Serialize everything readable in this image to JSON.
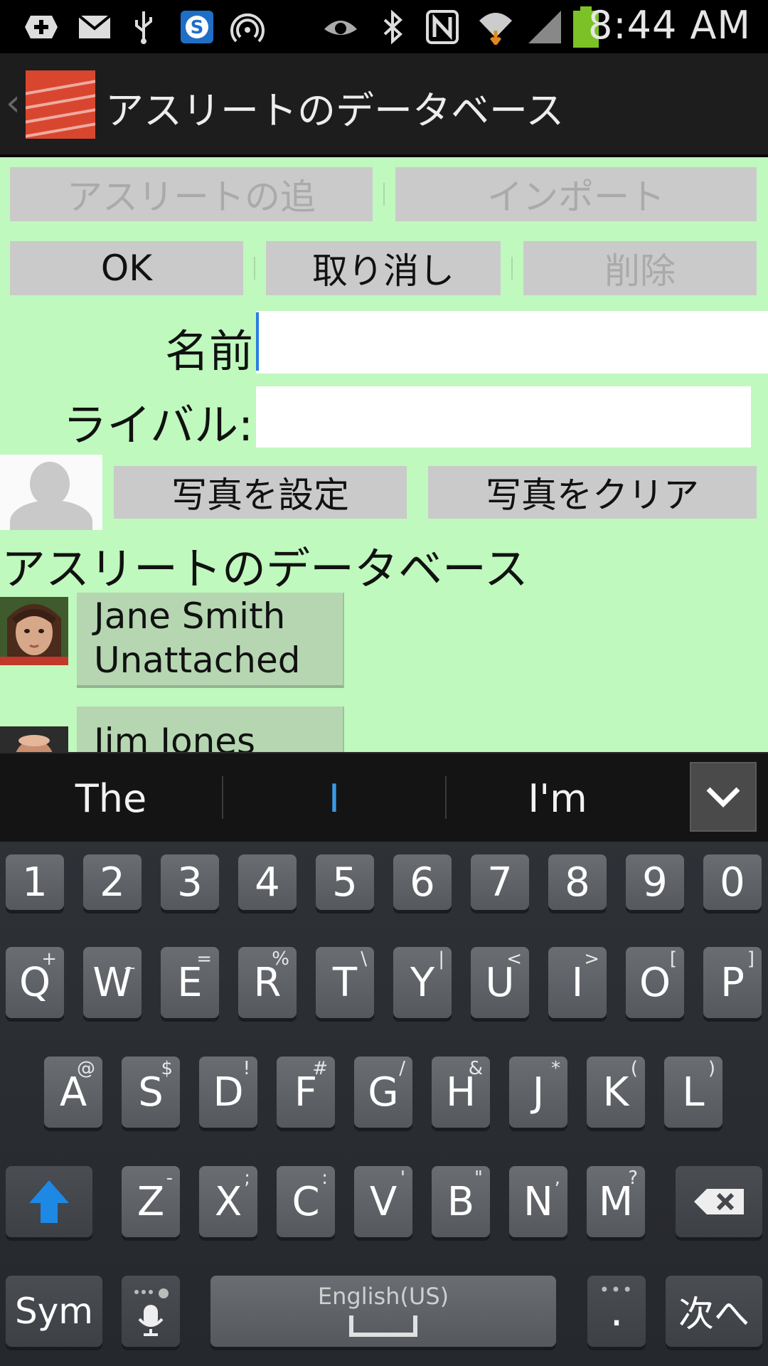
{
  "status_bar": {
    "time": "8:44 AM",
    "icons": [
      "add-notification-icon",
      "mail-icon",
      "usb-icon",
      "skype-icon",
      "hotspot-icon",
      "eye-icon",
      "bluetooth-icon",
      "nfc-icon",
      "wifi-icon",
      "signal-icon",
      "battery-icon"
    ]
  },
  "action_bar": {
    "title": "アスリートのデータベース"
  },
  "toolbar": {
    "add_athlete": "アスリートの追",
    "import": "インポート",
    "ok": "OK",
    "cancel": "取り消し",
    "delete": "削除"
  },
  "form": {
    "name_label": "名前",
    "name_value": "",
    "rival_label": "ライバル:",
    "rival_value": "",
    "set_photo": "写真を設定",
    "clear_photo": "写真をクリア"
  },
  "list": {
    "title": "アスリートのデータベース",
    "athletes": [
      {
        "name": "Jane Smith",
        "team": "Unattached"
      },
      {
        "name": "Jim Jones",
        "team": ""
      }
    ]
  },
  "suggestions": [
    "The",
    "I",
    "I'm"
  ],
  "keyboard": {
    "number_row": [
      "1",
      "2",
      "3",
      "4",
      "5",
      "6",
      "7",
      "8",
      "9",
      "0"
    ],
    "row1": [
      {
        "k": "Q",
        "s": "+"
      },
      {
        "k": "W",
        "s": "_"
      },
      {
        "k": "E",
        "s": "="
      },
      {
        "k": "R",
        "s": "%"
      },
      {
        "k": "T",
        "s": "\\"
      },
      {
        "k": "Y",
        "s": "|"
      },
      {
        "k": "U",
        "s": "<"
      },
      {
        "k": "I",
        "s": ">"
      },
      {
        "k": "O",
        "s": "["
      },
      {
        "k": "P",
        "s": "]"
      }
    ],
    "row2": [
      {
        "k": "A",
        "s": "@"
      },
      {
        "k": "S",
        "s": "$"
      },
      {
        "k": "D",
        "s": "!"
      },
      {
        "k": "F",
        "s": "#"
      },
      {
        "k": "G",
        "s": "/"
      },
      {
        "k": "H",
        "s": "&"
      },
      {
        "k": "J",
        "s": "*"
      },
      {
        "k": "K",
        "s": "("
      },
      {
        "k": "L",
        "s": ")"
      }
    ],
    "row3": [
      {
        "k": "Z",
        "s": "-"
      },
      {
        "k": "X",
        "s": ";"
      },
      {
        "k": "C",
        "s": ":"
      },
      {
        "k": "V",
        "s": "'"
      },
      {
        "k": "B",
        "s": "\""
      },
      {
        "k": "N",
        "s": ","
      },
      {
        "k": "M",
        "s": "?"
      }
    ],
    "sym": "Sym",
    "space_label": "English(US)",
    "period": ".",
    "next": "次へ"
  },
  "colors": {
    "content_bg": "#bff9bd",
    "button_bg": "#cacaca",
    "shift_accent": "#1e88e5",
    "cursor": "#2a7de1"
  }
}
